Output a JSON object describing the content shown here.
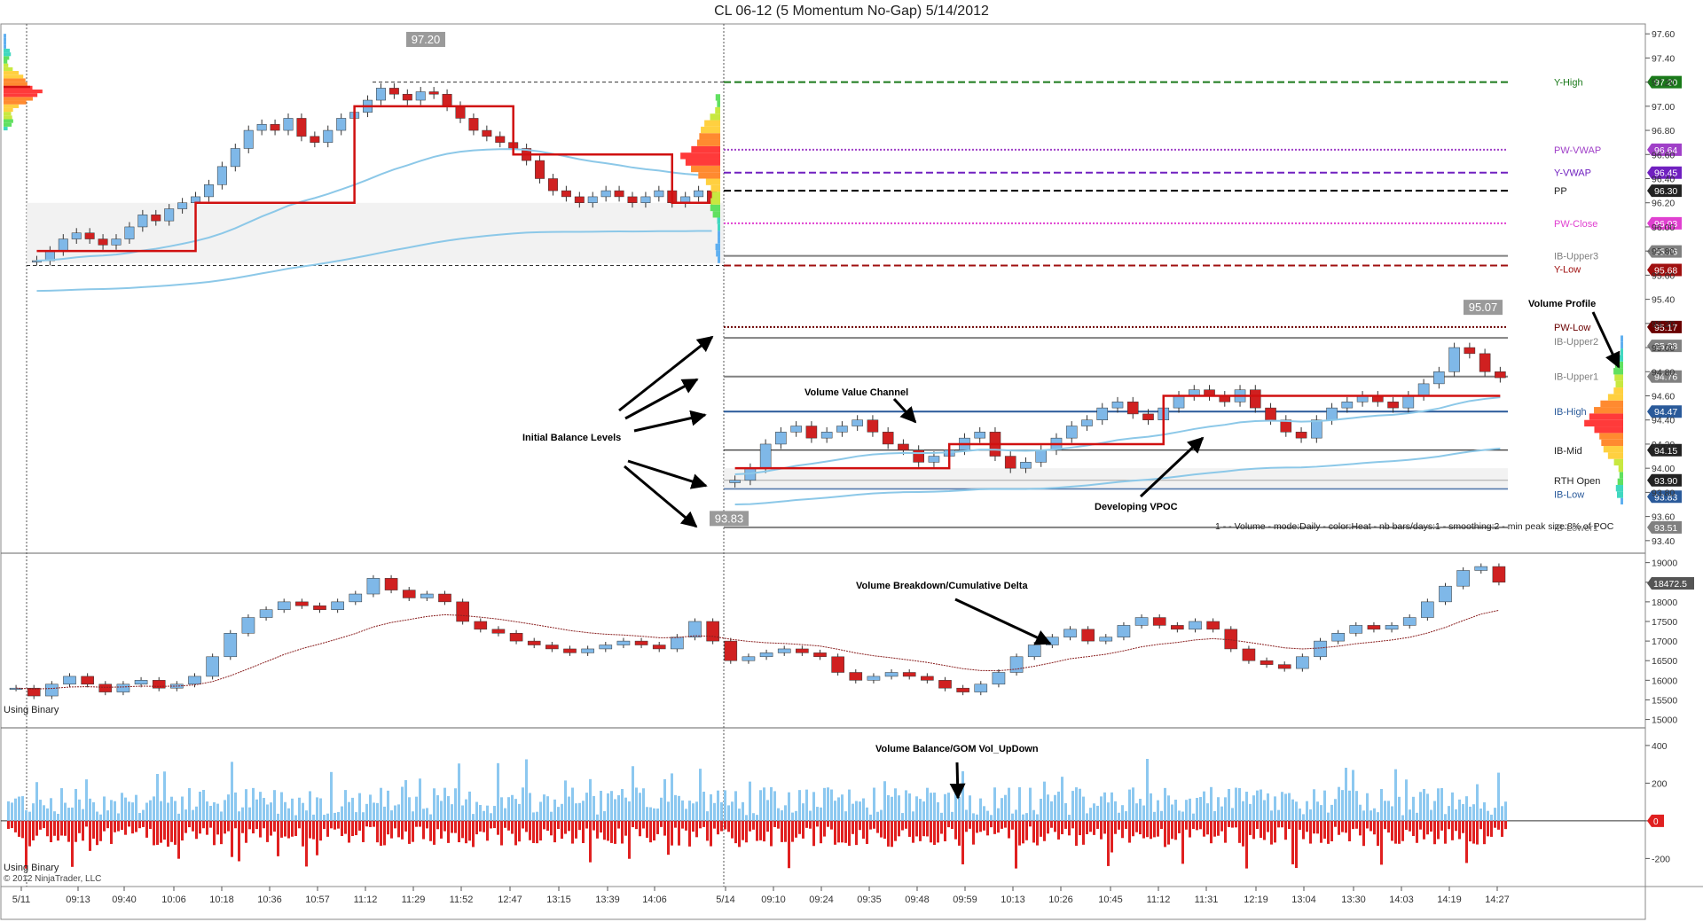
{
  "title": "CL 06-12 (5 Momentum No-Gap)  5/14/2012",
  "chart_data": [
    {
      "type": "line",
      "panel": "price",
      "y_ticks": [
        93.4,
        93.6,
        93.8,
        94.0,
        94.2,
        94.4,
        94.6,
        94.8,
        95.0,
        95.2,
        95.4,
        95.6,
        95.8,
        96.0,
        96.2,
        96.4,
        96.6,
        96.8,
        97.0,
        97.2,
        97.4,
        97.6
      ],
      "ylim": [
        93.34,
        97.66
      ],
      "x_tick_labels": [
        "5/11",
        "09:13",
        "09:40",
        "10:06",
        "10:18",
        "10:36",
        "10:57",
        "11:12",
        "11:29",
        "11:52",
        "12:47",
        "13:15",
        "13:39",
        "14:06",
        "5/14",
        "09:10",
        "09:24",
        "09:35",
        "09:48",
        "09:59",
        "10:13",
        "10:26",
        "10:45",
        "11:12",
        "11:31",
        "12:19",
        "13:04",
        "13:30",
        "14:03",
        "14:19",
        "14:27"
      ],
      "levels": [
        {
          "label": "Y-High",
          "value": 97.2,
          "color": "#1a7a1a",
          "badge": "97.20"
        },
        {
          "label": "PW-VWAP",
          "value": 96.64,
          "color": "#a040c8",
          "badge": "96.64"
        },
        {
          "label": "Y-VWAP",
          "value": 96.45,
          "color": "#7020c0",
          "badge": "96.45"
        },
        {
          "label": "PP",
          "value": 96.3,
          "color": "#000000",
          "badge": "96.30"
        },
        {
          "label": "PW-Close",
          "value": 96.03,
          "color": "#e040d0",
          "badge": "96.03"
        },
        {
          "label": "IB-Upper3",
          "value": 95.76,
          "color": "#808080",
          "badge": "95.76"
        },
        {
          "label": "Y-Low",
          "value": 95.68,
          "color": "#a01010",
          "badge": "95.68"
        },
        {
          "label": "PW-Low",
          "value": 95.17,
          "color": "#6a0000",
          "badge": "95.17"
        },
        {
          "label": "IB-Upper2",
          "value": 95.08,
          "color": "#808080",
          "badge": "95.08"
        },
        {
          "label": "IB-Upper1",
          "value": 94.76,
          "color": "#808080",
          "badge": "94.76"
        },
        {
          "label": "IB-High",
          "value": 94.47,
          "color": "#2a5a9a",
          "badge": "94.47"
        },
        {
          "label": "IB-Mid",
          "value": 94.15,
          "color": "#000000",
          "badge": "94.15"
        },
        {
          "label": "RTH Open",
          "value": 93.9,
          "color": "#000000",
          "badge": "93.90"
        },
        {
          "label": "IB-Low",
          "value": 93.83,
          "color": "#2a5a9a",
          "badge": "93.83"
        },
        {
          "label": "IB-Lower1",
          "value": 93.51,
          "color": "#808080",
          "badge": "93.51"
        }
      ],
      "labels_boxed": [
        "97.20",
        "95.07",
        "93.83"
      ],
      "day1_close": [
        95.72,
        95.8,
        95.9,
        95.95,
        95.9,
        95.85,
        95.9,
        96.0,
        96.1,
        96.05,
        96.15,
        96.2,
        96.25,
        96.35,
        96.5,
        96.65,
        96.8,
        96.85,
        96.8,
        96.9,
        96.75,
        96.7,
        96.8,
        96.9,
        96.95,
        97.05,
        97.15,
        97.1,
        97.05,
        97.12,
        97.1,
        97.0,
        96.9,
        96.8,
        96.75,
        96.7,
        96.65,
        96.55,
        96.4,
        96.3,
        96.25,
        96.2,
        96.25,
        96.3,
        96.25,
        96.2,
        96.25,
        96.3,
        96.2,
        96.25,
        96.3,
        96.2
      ],
      "day2_close": [
        93.9,
        94.0,
        94.2,
        94.3,
        94.35,
        94.25,
        94.3,
        94.35,
        94.4,
        94.3,
        94.2,
        94.15,
        94.05,
        94.1,
        94.15,
        94.25,
        94.3,
        94.1,
        94.0,
        94.05,
        94.15,
        94.25,
        94.35,
        94.4,
        94.5,
        94.55,
        94.45,
        94.4,
        94.5,
        94.6,
        94.65,
        94.6,
        94.55,
        94.65,
        94.5,
        94.4,
        94.3,
        94.25,
        94.4,
        94.5,
        94.55,
        94.6,
        94.55,
        94.5,
        94.6,
        94.7,
        94.8,
        95.0,
        94.95,
        94.8,
        94.75
      ]
    },
    {
      "type": "line",
      "panel": "volume-breakdown",
      "title": "Volume Breakdown/Cumulative Delta",
      "y_ticks": [
        15000,
        15500,
        16000,
        16500,
        17000,
        17500,
        18000,
        18500,
        19000
      ],
      "ylim": [
        14900,
        19150
      ],
      "last_value_badge": "18472.5",
      "panel_label": "Using Binary",
      "values": [
        15800,
        15600,
        15900,
        16100,
        15900,
        15700,
        15900,
        16000,
        15800,
        15900,
        16100,
        16600,
        17200,
        17600,
        17800,
        18000,
        17900,
        17800,
        18000,
        18200,
        18600,
        18300,
        18100,
        18200,
        18000,
        17500,
        17300,
        17200,
        17000,
        16900,
        16800,
        16700,
        16800,
        16900,
        17000,
        16900,
        16800,
        17100,
        17500,
        17000,
        16500,
        16600,
        16700,
        16800,
        16700,
        16600,
        16200,
        16000,
        16100,
        16200,
        16100,
        16000,
        15800,
        15700,
        15900,
        16200,
        16600,
        16900,
        17100,
        17300,
        17000,
        17100,
        17400,
        17600,
        17400,
        17300,
        17500,
        17300,
        16800,
        16500,
        16400,
        16300,
        16600,
        17000,
        17200,
        17400,
        17300,
        17400,
        17600,
        18000,
        18400,
        18800,
        18900,
        18500
      ]
    },
    {
      "type": "bar",
      "panel": "volume-balance",
      "title": "Volume Balance/GOM Vol_UpDown",
      "y_ticks": [
        -200,
        0,
        200,
        400
      ],
      "ylim": [
        -330,
        470
      ],
      "last_value_badge": "0",
      "panel_label": "Using Binary",
      "copyright": "© 2012 NinjaTrader, LLC"
    }
  ],
  "annotations": {
    "initial_balance": "Initial Balance Levels",
    "volume_value_channel": "Volume Value Channel",
    "developing_vpoc": "Developing VPOC",
    "volume_profile": "Volume Profile",
    "volume_breakdown": "Volume Breakdown/Cumulative Delta",
    "volume_balance": "Volume Balance/GOM Vol_UpDown",
    "profile_settings": "1 -  - Volume - mode:Daily - color:Heat - nb bars/days:1 - smoothing:2 - min peak size:8% of POC"
  },
  "colors": {
    "up_bar": "#8cc8f0",
    "down_bar": "#e02020",
    "candle_up": "#7fb8e8",
    "candle_down": "#d02020",
    "vwap_line": "#8cc8e8",
    "vpoc_line": "#d01010",
    "delta_avg": "#8a2020"
  }
}
